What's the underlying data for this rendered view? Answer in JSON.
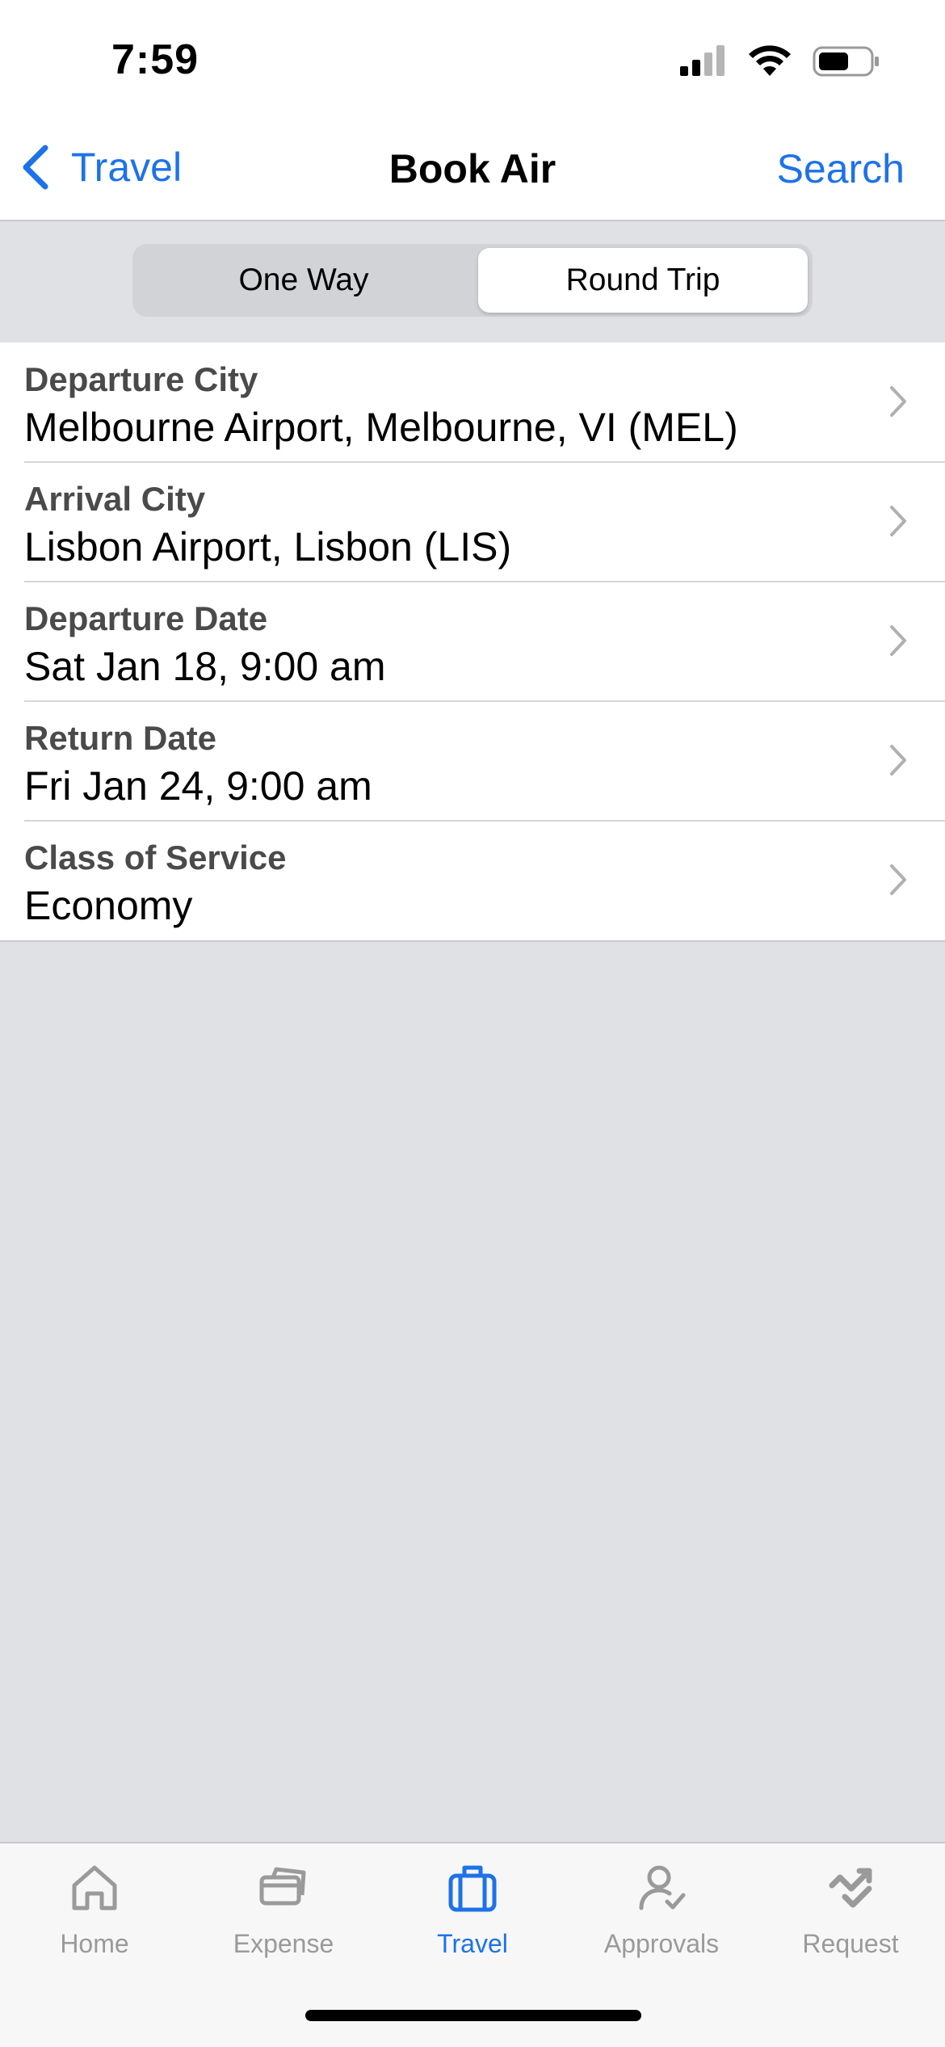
{
  "status_bar": {
    "time": "7:59",
    "icons": [
      "cellular-signal-icon",
      "wifi-icon",
      "battery-icon"
    ]
  },
  "nav": {
    "back_label": "Travel",
    "title": "Book Air",
    "action_label": "Search"
  },
  "trip_type": {
    "options": [
      "One Way",
      "Round Trip"
    ],
    "selected": "Round Trip"
  },
  "form": {
    "rows": [
      {
        "label": "Departure City",
        "value": "Melbourne Airport, Melbourne, VI (MEL)"
      },
      {
        "label": "Arrival City",
        "value": "Lisbon Airport, Lisbon (LIS)"
      },
      {
        "label": "Departure Date",
        "value": "Sat Jan 18, 9:00 am"
      },
      {
        "label": "Return Date",
        "value": "Fri Jan 24, 9:00 am"
      },
      {
        "label": "Class of Service",
        "value": "Economy"
      }
    ]
  },
  "tab_bar": {
    "tabs": [
      {
        "label": "Home",
        "icon": "home-icon"
      },
      {
        "label": "Expense",
        "icon": "expense-icon"
      },
      {
        "label": "Travel",
        "icon": "suitcase-icon"
      },
      {
        "label": "Approvals",
        "icon": "approvals-icon"
      },
      {
        "label": "Request",
        "icon": "request-icon"
      }
    ],
    "active": "Travel"
  },
  "colors": {
    "accent": "#1d72e8",
    "background": "#e0e1e4",
    "inactive_tab": "#9a9a9a"
  }
}
